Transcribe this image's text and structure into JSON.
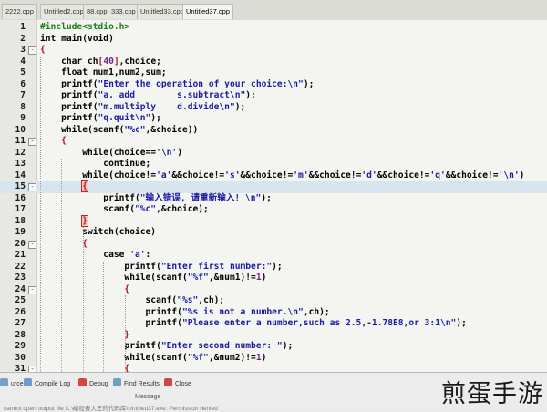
{
  "tabs": [
    {
      "label": "2222.cpp"
    },
    {
      "label": "Untitled2.cpp"
    },
    {
      "label": "88.cpp"
    },
    {
      "label": "333.cpp"
    },
    {
      "label": "Untitled33.cpp"
    },
    {
      "label": "Untitled37.cpp"
    }
  ],
  "active_tab_index": 5,
  "highlight_line": 15,
  "lines": [
    {
      "n": "1",
      "fold": "",
      "segs": [
        {
          "t": "#include<stdio.h>",
          "c": "pp"
        }
      ]
    },
    {
      "n": "2",
      "fold": "",
      "segs": [
        {
          "t": "int main(void)",
          "c": "k"
        }
      ]
    },
    {
      "n": "3",
      "fold": "-",
      "segs": [
        {
          "t": "{",
          "c": "p"
        }
      ]
    },
    {
      "n": "4",
      "fold": "",
      "segs": [
        {
          "t": "    char ch",
          "c": ""
        },
        {
          "t": "[",
          "c": "p"
        },
        {
          "t": "40",
          "c": "n"
        },
        {
          "t": "]",
          "c": "p"
        },
        {
          "t": ",choice;",
          "c": ""
        }
      ]
    },
    {
      "n": "5",
      "fold": "",
      "segs": [
        {
          "t": "    float num1,num2,sum;",
          "c": ""
        }
      ]
    },
    {
      "n": "6",
      "fold": "",
      "segs": [
        {
          "t": "    printf(",
          "c": ""
        },
        {
          "t": "\"Enter the operation of your choice:\\n\"",
          "c": "s"
        },
        {
          "t": ");",
          "c": ""
        }
      ]
    },
    {
      "n": "7",
      "fold": "",
      "segs": [
        {
          "t": "    printf(",
          "c": ""
        },
        {
          "t": "\"a. add        s.subtract\\n\"",
          "c": "s"
        },
        {
          "t": ");",
          "c": ""
        }
      ]
    },
    {
      "n": "8",
      "fold": "",
      "segs": [
        {
          "t": "    printf(",
          "c": ""
        },
        {
          "t": "\"m.multiply    d.divide\\n\"",
          "c": "s"
        },
        {
          "t": ");",
          "c": ""
        }
      ]
    },
    {
      "n": "9",
      "fold": "",
      "segs": [
        {
          "t": "    printf(",
          "c": ""
        },
        {
          "t": "\"q.quit\\n\"",
          "c": "s"
        },
        {
          "t": ");",
          "c": ""
        }
      ]
    },
    {
      "n": "10",
      "fold": "",
      "segs": [
        {
          "t": "    while(scanf(",
          "c": ""
        },
        {
          "t": "\"%c\"",
          "c": "s"
        },
        {
          "t": ",&choice))",
          "c": ""
        }
      ]
    },
    {
      "n": "11",
      "fold": "-",
      "segs": [
        {
          "t": "    {",
          "c": "p"
        }
      ]
    },
    {
      "n": "12",
      "fold": "",
      "segs": [
        {
          "t": "        while(choice==",
          "c": ""
        },
        {
          "t": "'\\n'",
          "c": "s"
        },
        {
          "t": ")",
          "c": ""
        }
      ]
    },
    {
      "n": "13",
      "fold": "",
      "segs": [
        {
          "t": "            continue;",
          "c": ""
        }
      ]
    },
    {
      "n": "14",
      "fold": "",
      "segs": [
        {
          "t": "        while(choice!=",
          "c": ""
        },
        {
          "t": "'a'",
          "c": "s"
        },
        {
          "t": "&&choice!=",
          "c": ""
        },
        {
          "t": "'s'",
          "c": "s"
        },
        {
          "t": "&&choice!=",
          "c": ""
        },
        {
          "t": "'m'",
          "c": "s"
        },
        {
          "t": "&&choice!=",
          "c": ""
        },
        {
          "t": "'d'",
          "c": "s"
        },
        {
          "t": "&&choice!=",
          "c": ""
        },
        {
          "t": "'q'",
          "c": "s"
        },
        {
          "t": "&&choice!=",
          "c": ""
        },
        {
          "t": "'\\n'",
          "c": "s"
        },
        {
          "t": ")",
          "c": ""
        }
      ]
    },
    {
      "n": "15",
      "fold": "-",
      "segs": [
        {
          "t": "        ",
          "c": ""
        },
        {
          "t": "{",
          "c": "p box"
        }
      ]
    },
    {
      "n": "16",
      "fold": "",
      "segs": [
        {
          "t": "            printf(",
          "c": ""
        },
        {
          "t": "\"输入错误, 请重新输入! \\n\"",
          "c": "s"
        },
        {
          "t": ");",
          "c": ""
        }
      ]
    },
    {
      "n": "17",
      "fold": "",
      "segs": [
        {
          "t": "            scanf(",
          "c": ""
        },
        {
          "t": "\"%c\"",
          "c": "s"
        },
        {
          "t": ",&choice);",
          "c": ""
        }
      ]
    },
    {
      "n": "18",
      "fold": "",
      "segs": [
        {
          "t": "        ",
          "c": ""
        },
        {
          "t": "}",
          "c": "p box"
        }
      ]
    },
    {
      "n": "19",
      "fold": "",
      "segs": [
        {
          "t": "        switch(choice)",
          "c": ""
        }
      ]
    },
    {
      "n": "20",
      "fold": "-",
      "segs": [
        {
          "t": "        {",
          "c": "p"
        }
      ]
    },
    {
      "n": "21",
      "fold": "",
      "segs": [
        {
          "t": "            case ",
          "c": ""
        },
        {
          "t": "'a'",
          "c": "s"
        },
        {
          "t": ":",
          "c": ""
        }
      ]
    },
    {
      "n": "22",
      "fold": "",
      "segs": [
        {
          "t": "                printf(",
          "c": ""
        },
        {
          "t": "\"Enter first number:\"",
          "c": "s"
        },
        {
          "t": ");",
          "c": ""
        }
      ]
    },
    {
      "n": "23",
      "fold": "",
      "segs": [
        {
          "t": "                while(scanf(",
          "c": ""
        },
        {
          "t": "\"%f\"",
          "c": "s"
        },
        {
          "t": ",&num1)!=",
          "c": ""
        },
        {
          "t": "1",
          "c": "n"
        },
        {
          "t": ")",
          "c": ""
        }
      ]
    },
    {
      "n": "24",
      "fold": "-",
      "segs": [
        {
          "t": "                {",
          "c": "p"
        }
      ]
    },
    {
      "n": "25",
      "fold": "",
      "segs": [
        {
          "t": "                    scanf(",
          "c": ""
        },
        {
          "t": "\"%s\"",
          "c": "s"
        },
        {
          "t": ",ch);",
          "c": ""
        }
      ]
    },
    {
      "n": "26",
      "fold": "",
      "segs": [
        {
          "t": "                    printf(",
          "c": ""
        },
        {
          "t": "\"%s is not a number.\\n\"",
          "c": "s"
        },
        {
          "t": ",ch);",
          "c": ""
        }
      ]
    },
    {
      "n": "27",
      "fold": "",
      "segs": [
        {
          "t": "                    printf(",
          "c": ""
        },
        {
          "t": "\"Please enter a number,such as 2.5,-1.78E8,or 3:1\\n\"",
          "c": "s"
        },
        {
          "t": ");",
          "c": ""
        }
      ]
    },
    {
      "n": "28",
      "fold": "",
      "segs": [
        {
          "t": "                }",
          "c": "p"
        }
      ]
    },
    {
      "n": "29",
      "fold": "",
      "segs": [
        {
          "t": "                printf(",
          "c": ""
        },
        {
          "t": "\"Enter second number: \"",
          "c": "s"
        },
        {
          "t": ");",
          "c": ""
        }
      ]
    },
    {
      "n": "30",
      "fold": "",
      "segs": [
        {
          "t": "                while(scanf(",
          "c": ""
        },
        {
          "t": "\"%f\"",
          "c": "s"
        },
        {
          "t": ",&num2)!=",
          "c": ""
        },
        {
          "t": "1",
          "c": "n"
        },
        {
          "t": ")",
          "c": ""
        }
      ]
    },
    {
      "n": "31",
      "fold": "-",
      "segs": [
        {
          "t": "                {",
          "c": "p"
        }
      ]
    }
  ],
  "bottom_tabs": [
    {
      "label": "urces",
      "icon": "resources-icon"
    },
    {
      "label": "Compile Log",
      "icon": "compile-log-icon"
    },
    {
      "label": "Debug",
      "icon": "debug-icon"
    },
    {
      "label": "Find Results",
      "icon": "find-results-icon"
    },
    {
      "label": "Close",
      "icon": "close-icon"
    }
  ],
  "message_header": "Message",
  "message_row": "cannot open output file C:\\编程者大王的代码库\\Untitled37.exe: Permission denied",
  "watermark": "煎蛋手游"
}
